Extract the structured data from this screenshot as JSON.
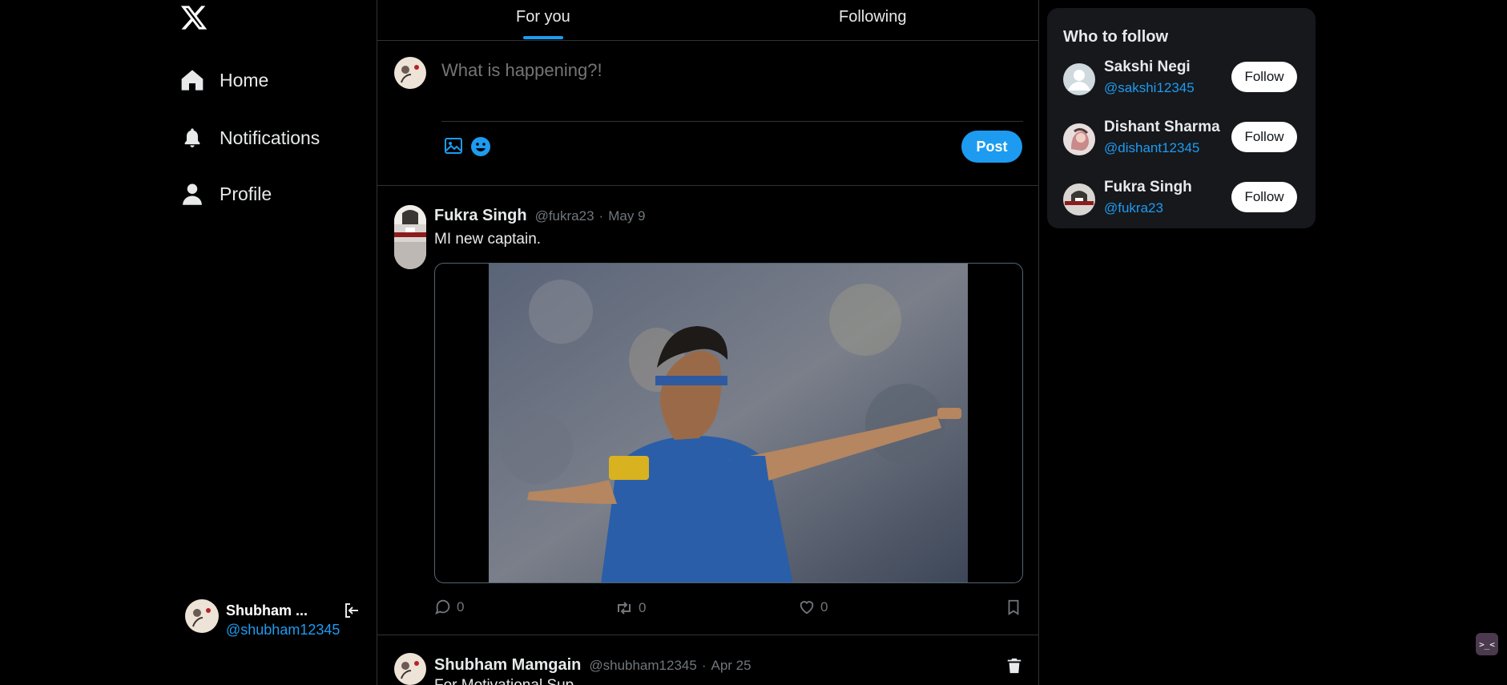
{
  "nav": {
    "logo_icon": "x-logo-icon",
    "items": [
      {
        "label": "Home",
        "icon": "home-icon"
      },
      {
        "label": "Notifications",
        "icon": "bell-icon"
      },
      {
        "label": "Profile",
        "icon": "user-icon"
      }
    ],
    "account": {
      "name": "Shubham ...",
      "handle": "@shubham12345",
      "logout_icon": "logout-icon"
    }
  },
  "tabs": [
    {
      "label": "For you",
      "active": true
    },
    {
      "label": "Following",
      "active": false
    }
  ],
  "composer": {
    "placeholder": "What is happening?!",
    "icons": [
      "image-icon",
      "emoji-icon"
    ],
    "post_label": "Post"
  },
  "tweets": [
    {
      "name": "Fukra Singh",
      "handle": "@fukra23",
      "separator": "·",
      "date": "May 9",
      "text": "MI new captain.",
      "has_media": true,
      "reply_count": "0",
      "retweet_count": "0",
      "like_count": "0"
    },
    {
      "name": "Shubham Mamgain",
      "handle": "@shubham12345",
      "separator": "·",
      "date": "Apr 25",
      "text": "For Motivational Sup..."
    }
  ],
  "who_to_follow": {
    "title": "Who to follow",
    "follow_label": "Follow",
    "users": [
      {
        "name": "Sakshi Negi",
        "handle": "@sakshi12345"
      },
      {
        "name": "Dishant Sharma",
        "handle": "@dishant12345"
      },
      {
        "name": "Fukra Singh",
        "handle": "@fukra23"
      }
    ]
  },
  "colors": {
    "background": "#000000",
    "accent": "#1d9bf0",
    "border": "#2f3336",
    "muted": "#71767b",
    "panel": "#16181c"
  },
  "corner_widget": {
    "label": ">_<"
  }
}
